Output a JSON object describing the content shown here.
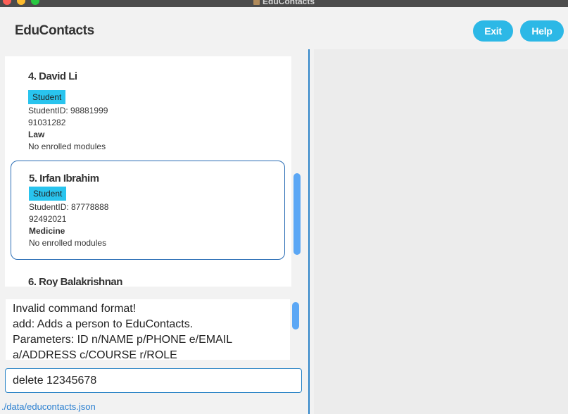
{
  "window": {
    "title": "EduContacts"
  },
  "header": {
    "app_name": "EduContacts",
    "exit_label": "Exit",
    "help_label": "Help"
  },
  "colors": {
    "accent": "#2cb8e6",
    "role_badge": "#29c4ee",
    "selection_border": "#2a6db5",
    "scroll_thumb": "#5ba7f5",
    "status_link": "#2a7fd0"
  },
  "contacts": [
    {
      "name": "4. David Li",
      "role": "Student",
      "student_id": "StudentID: 98881999",
      "phone": "91031282",
      "course": "Law",
      "modules": "No enrolled modules"
    },
    {
      "name": "5. Irfan Ibrahim",
      "role": "Student",
      "student_id": "StudentID: 87778888",
      "phone": "92492021",
      "course": "Medicine",
      "modules": "No enrolled modules",
      "selected": true
    },
    {
      "name": "6. Roy Balakrishnan"
    }
  ],
  "result": {
    "lines": [
      "Invalid command format!",
      "add: Adds a person to EduContacts.",
      "Parameters: ID n/NAME p/PHONE e/EMAIL",
      "a/ADDRESS c/COURSE r/ROLE"
    ]
  },
  "command": {
    "value": "delete 12345678"
  },
  "status": {
    "path": "./data/educontacts.json"
  }
}
